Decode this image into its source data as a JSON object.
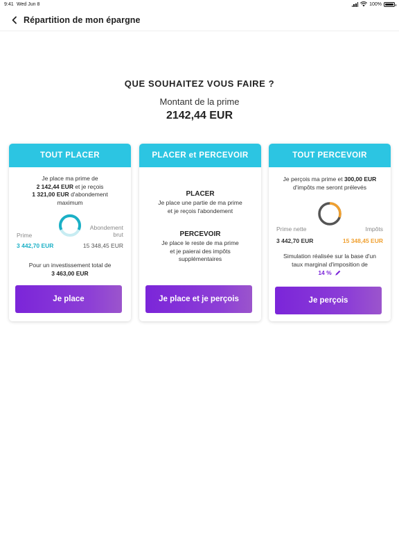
{
  "status_bar": {
    "time": "9:41",
    "date": "Wed Jun 8",
    "battery": "100%",
    "battery_level": 1.0
  },
  "header": {
    "title": "Répartition de mon épargne"
  },
  "main": {
    "question": "QUE SOUHAITEZ VOUS FAIRE ?",
    "amount_label": "Montant de la prime",
    "amount_value": "2142,44 EUR"
  },
  "cards": [
    {
      "title": "TOUT PLACER",
      "intro_1": "Je place ma prime de",
      "intro_2a": "2 142,44 EUR",
      "intro_2b": " et je reçois",
      "intro_3a": "1 321,00 EUR",
      "intro_3b": " d'abondement",
      "intro_4": "maximum",
      "left_label": "Prime",
      "left_value": "3 442,70 EUR",
      "right_label_1": "Abondement",
      "right_label_2": "brut",
      "right_value": "15 348,45 EUR",
      "total_1": "Pour un investissement total de",
      "total_2": "3 463,00 EUR",
      "button": "Je place",
      "colors": {
        "primary": "#1bb0c6",
        "secondary": "#c7ecf2"
      }
    },
    {
      "title": "PLACER et PERCEVOIR",
      "placer_title": "PLACER",
      "placer_1": "Je place une partie de ma prime",
      "placer_2": "et je reçois l'abondement",
      "percevoir_title": "PERCEVOIR",
      "percevoir_1": "Je place le reste de ma prime",
      "percevoir_2": "et je paierai des impôts",
      "percevoir_3": "supplémentaires",
      "button": "Je place et je perçois"
    },
    {
      "title": "TOUT PERCEVOIR",
      "intro_1a": "Je perçois ma prime et ",
      "intro_1b": "300,00 EUR",
      "intro_2": "d'impôts me seront prélevés",
      "left_label": "Prime nette",
      "left_value": "3 442,70 EUR",
      "right_label": "Impôts",
      "right_value": "15 348,45 EUR",
      "sim_1": "Simulation réalisée sur la base d'un",
      "sim_2": "taux marginal d'imposition de",
      "rate": "14 %",
      "button": "Je perçois",
      "colors": {
        "primary": "#555555",
        "secondary": "#f0a030"
      }
    }
  ],
  "colors": {
    "accent": "#2cc5e2",
    "button": "#7b25d9",
    "orange": "#f0a030",
    "teal": "#1bb0c6"
  },
  "icons": {
    "back": "chevron-left-icon",
    "edit": "pencil-icon"
  }
}
